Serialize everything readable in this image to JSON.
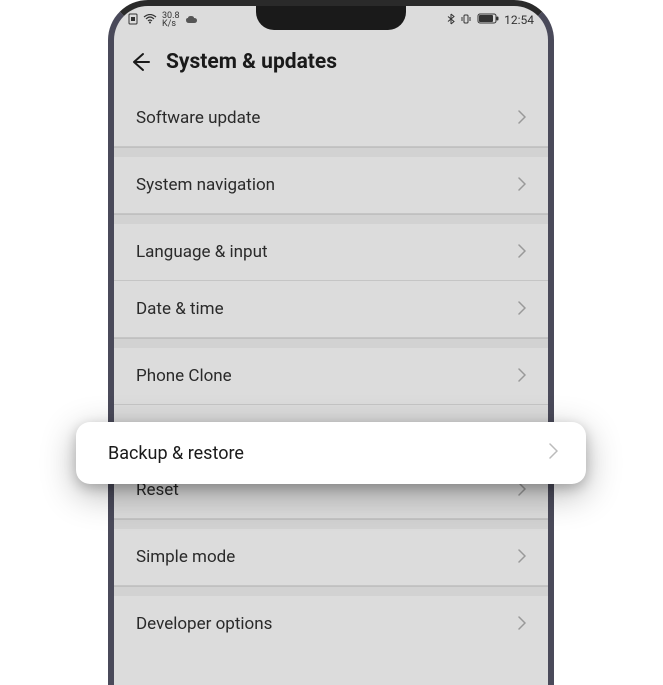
{
  "status": {
    "speed_value": "30.8",
    "speed_unit": "K/s",
    "time": "12:54"
  },
  "header": {
    "title": "System & updates"
  },
  "menu": {
    "software_update": "Software update",
    "system_navigation": "System navigation",
    "language_input": "Language & input",
    "date_time": "Date & time",
    "phone_clone": "Phone Clone",
    "backup_restore": "Backup & restore",
    "reset": "Reset",
    "simple_mode": "Simple mode",
    "developer_options": "Developer options"
  }
}
